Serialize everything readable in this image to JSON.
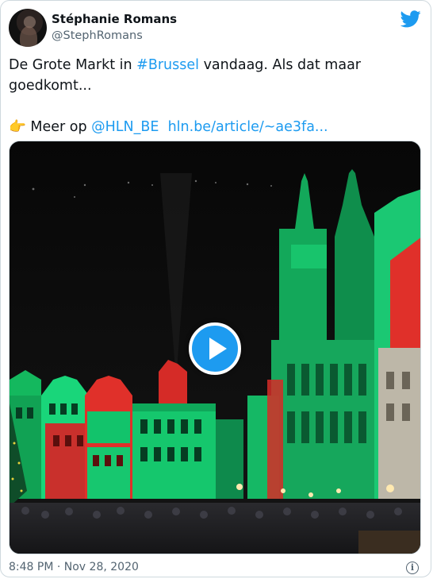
{
  "tweet": {
    "author_name": "Stéphanie Romans",
    "author_handle": "@StephRomans",
    "text_part1": "De Grote Markt in ",
    "hashtag": "#Brussel",
    "text_part2": " vandaag. Als dat maar goedkomt...",
    "pointing_emoji": "👉",
    "meer_op": " Meer op ",
    "mention": "@HLN_BE",
    "url_text": "hln.be/article/~ae3fa...",
    "timestamp": "8:48 PM · Nov 28, 2020",
    "info_glyph": "i"
  },
  "colors": {
    "accent": "#1d9bf0",
    "secondary_text": "#536471",
    "primary_text": "#0f1419",
    "border": "#cfd9de",
    "facade_green": "#19d67a",
    "facade_red": "#e0302a"
  },
  "icons": [
    "twitter-bird-icon",
    "play-icon",
    "info-icon",
    "pointing-hand-emoji"
  ]
}
